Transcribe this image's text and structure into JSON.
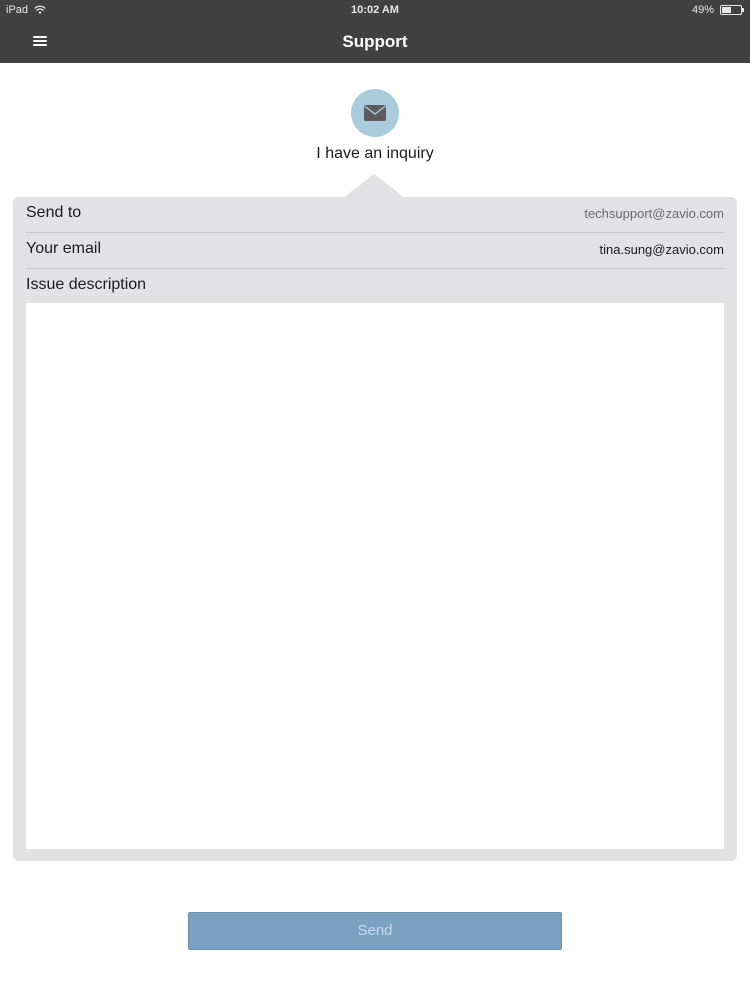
{
  "status_bar": {
    "carrier": "iPad",
    "time": "10:02 AM",
    "battery_percent": "49%",
    "battery_level": 0.49,
    "wifi_icon": "wifi-icon"
  },
  "nav": {
    "title": "Support",
    "menu_icon": "hamburger-menu-icon"
  },
  "inquiry": {
    "icon": "mail-icon",
    "label": "I have an inquiry"
  },
  "form": {
    "send_to_label": "Send to",
    "send_to_value": "techsupport@zavio.com",
    "your_email_label": "Your email",
    "your_email_value": "tina.sung@zavio.com",
    "issue_label": "Issue description",
    "issue_value": ""
  },
  "send_button": {
    "label": "Send"
  },
  "colors": {
    "nav_bg": "#424142",
    "panel_bg": "#e2e1e4",
    "icon_circle": "#a9cbdc",
    "button_bg": "#7aa1c2",
    "button_text": "#c8d9e8"
  }
}
